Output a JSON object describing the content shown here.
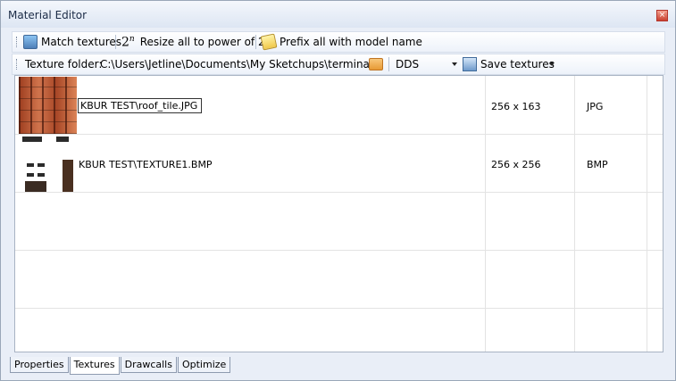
{
  "window": {
    "title": "Material Editor",
    "close_glyph": "×"
  },
  "toolbar1": {
    "match_textures": "Match textures",
    "power_glyph": "2",
    "power_exp": "n",
    "resize_power": "Resize all to power of 2",
    "prefix_model": "Prefix all with model name"
  },
  "toolbar2": {
    "texture_folder_label": "Texture folder:",
    "texture_folder_path": "C:\\Users\\Jetline\\Documents\\My Sketchups\\terminal",
    "format_selected": "DDS",
    "save_textures": "Save textures"
  },
  "textures": [
    {
      "name": "KBUR TEST\\roof_tile.JPG",
      "size": "256 x 163",
      "format": "JPG",
      "thumbnail_icon": "roof-tile-thumbnail"
    },
    {
      "name": "KBUR TEST\\TEXTURE1.BMP",
      "size": "256 x 256",
      "format": "BMP",
      "thumbnail_icon": "building-texture-thumbnail"
    }
  ],
  "tabs": [
    "Properties",
    "Textures",
    "Drawcalls",
    "Optimize"
  ],
  "active_tab": "Textures",
  "colors": {
    "title_text": "#1b2b46",
    "close_button": "#c9402f",
    "folder_icon": "#e79a35"
  }
}
